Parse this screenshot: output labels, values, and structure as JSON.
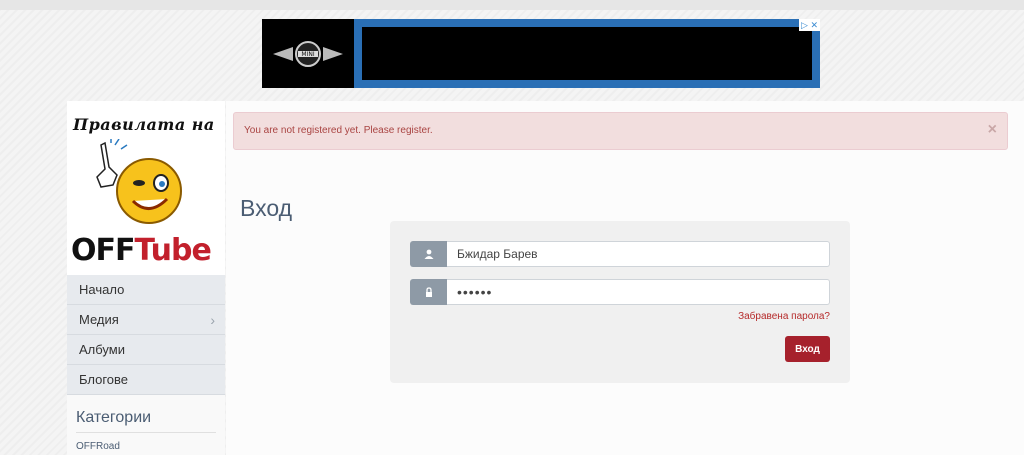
{
  "ad": {
    "brand_text": "MINI",
    "choices": "▷ ✕"
  },
  "sidebar": {
    "logo_top": "Правилата на",
    "logo_brand_a": "OFF",
    "logo_brand_b": "Tube",
    "nav": [
      {
        "label": "Начало"
      },
      {
        "label": "Медия",
        "has_children": true
      },
      {
        "label": "Албуми"
      },
      {
        "label": "Блогове"
      }
    ],
    "categories_title": "Категории",
    "categories": [
      "OFFRoad"
    ]
  },
  "alert": {
    "text": "You are not registered yet. Please register.",
    "close": "×"
  },
  "login": {
    "title": "Вход",
    "username_value": "Бжидар Барев",
    "password_value": "••••••",
    "forgot_link": "Забравена парола?",
    "submit_label": "Вход"
  },
  "colors": {
    "accent": "#a6212c",
    "alert_bg": "#f2dede",
    "alert_text": "#a94442",
    "nav_bg": "#e7eaee"
  }
}
